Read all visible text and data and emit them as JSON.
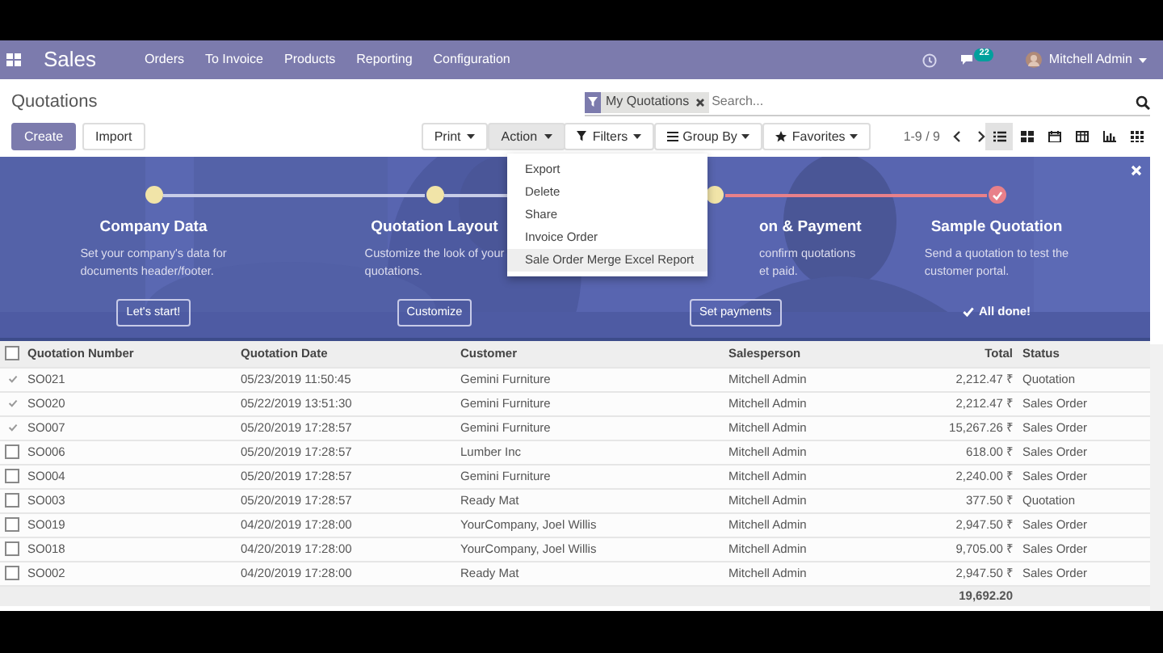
{
  "navbar": {
    "app": "Sales",
    "menu": [
      "Orders",
      "To Invoice",
      "Products",
      "Reporting",
      "Configuration"
    ],
    "chat_count": "22",
    "user": "Mitchell Admin"
  },
  "breadcrumb": "Quotations",
  "search": {
    "facet": "My Quotations",
    "placeholder": "Search..."
  },
  "buttons": [
    {
      "label": "Create",
      "kind": "primary"
    },
    {
      "label": "Import",
      "kind": "secondary"
    }
  ],
  "actions": [
    {
      "label": "Print",
      "selected": false
    },
    {
      "label": "Action",
      "selected": true
    }
  ],
  "action_menu": [
    {
      "label": "Export",
      "selected": false
    },
    {
      "label": "Delete",
      "selected": false
    },
    {
      "label": "Share",
      "selected": false
    },
    {
      "label": "Invoice Order",
      "selected": false
    },
    {
      "label": "Sale Order Merge Excel Report",
      "selected": true
    }
  ],
  "filters": [
    {
      "kind": "filter",
      "label": "Filters"
    },
    {
      "kind": "group",
      "label": "Group By"
    },
    {
      "kind": "star",
      "label": "Favorites"
    }
  ],
  "pager": "1-9 / 9",
  "views": [
    {
      "kind": "list",
      "selected": true
    },
    {
      "kind": "kanban",
      "selected": false
    },
    {
      "kind": "calendar",
      "selected": false
    },
    {
      "kind": "pivot",
      "selected": false
    },
    {
      "kind": "graph",
      "selected": false
    },
    {
      "kind": "activity",
      "selected": false
    }
  ],
  "onboarding": {
    "steps": [
      {
        "kind": "step",
        "title": "Company Data",
        "lines": [
          "Set your company's data for",
          "documents header/footer."
        ],
        "button": "Let's start!",
        "done": false
      },
      {
        "kind": "step",
        "title": "Quotation Layout",
        "lines": [
          "Customize the look of your",
          "quotations."
        ],
        "button": "Customize",
        "done": false
      },
      {
        "kind": "partial",
        "title": "on & Payment",
        "lines": [
          "confirm quotations",
          "et paid."
        ],
        "button": "Set payments",
        "done": false
      },
      {
        "kind": "step",
        "title": "Sample Quotation",
        "lines": [
          "Send a quotation to test the",
          "customer portal."
        ],
        "status": "All done!",
        "done": true
      }
    ]
  },
  "table": {
    "select_all": false,
    "columns": [
      "Quotation Number",
      "Quotation Date",
      "Customer",
      "Salesperson",
      "Total",
      "Status"
    ],
    "rows": [
      {
        "selected": true,
        "cells": [
          "SO021",
          "05/23/2019 11:50:45",
          "Gemini Furniture",
          "Mitchell Admin",
          "2,212.47 ₹",
          "Quotation"
        ]
      },
      {
        "selected": true,
        "cells": [
          "SO020",
          "05/22/2019 13:51:30",
          "Gemini Furniture",
          "Mitchell Admin",
          "2,212.47 ₹",
          "Sales Order"
        ]
      },
      {
        "selected": true,
        "cells": [
          "SO007",
          "05/20/2019 17:28:57",
          "Gemini Furniture",
          "Mitchell Admin",
          "15,267.26 ₹",
          "Sales Order"
        ]
      },
      {
        "selected": false,
        "cells": [
          "SO006",
          "05/20/2019 17:28:57",
          "Lumber Inc",
          "Mitchell Admin",
          "618.00 ₹",
          "Sales Order"
        ]
      },
      {
        "selected": false,
        "cells": [
          "SO004",
          "05/20/2019 17:28:57",
          "Gemini Furniture",
          "Mitchell Admin",
          "2,240.00 ₹",
          "Sales Order"
        ]
      },
      {
        "selected": false,
        "cells": [
          "SO003",
          "05/20/2019 17:28:57",
          "Ready Mat",
          "Mitchell Admin",
          "377.50 ₹",
          "Quotation"
        ]
      },
      {
        "selected": false,
        "cells": [
          "SO019",
          "04/20/2019 17:28:00",
          "YourCompany, Joel Willis",
          "Mitchell Admin",
          "2,947.50 ₹",
          "Sales Order"
        ]
      },
      {
        "selected": false,
        "cells": [
          "SO018",
          "04/20/2019 17:28:00",
          "YourCompany, Joel Willis",
          "Mitchell Admin",
          "9,705.00 ₹",
          "Sales Order"
        ]
      },
      {
        "selected": false,
        "cells": [
          "SO002",
          "04/20/2019 17:28:00",
          "Ready Mat",
          "Mitchell Admin",
          "2,947.50 ₹",
          "Sales Order"
        ]
      }
    ],
    "total": "19,692.20"
  }
}
